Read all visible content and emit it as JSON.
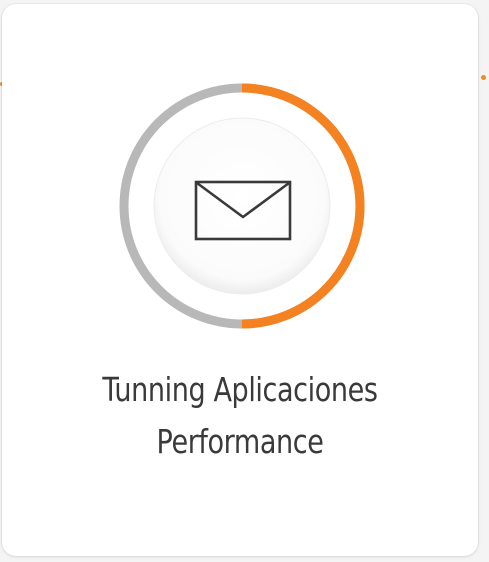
{
  "card": {
    "title_line1": "Tunning Aplicaciones",
    "title_line2": "Performance",
    "icon": "envelope-icon",
    "progress_percent": 50
  },
  "colors": {
    "accent": "#f58220",
    "track": "#b8b8b8",
    "text": "#3a3a3a",
    "card_background": "#ffffff"
  }
}
